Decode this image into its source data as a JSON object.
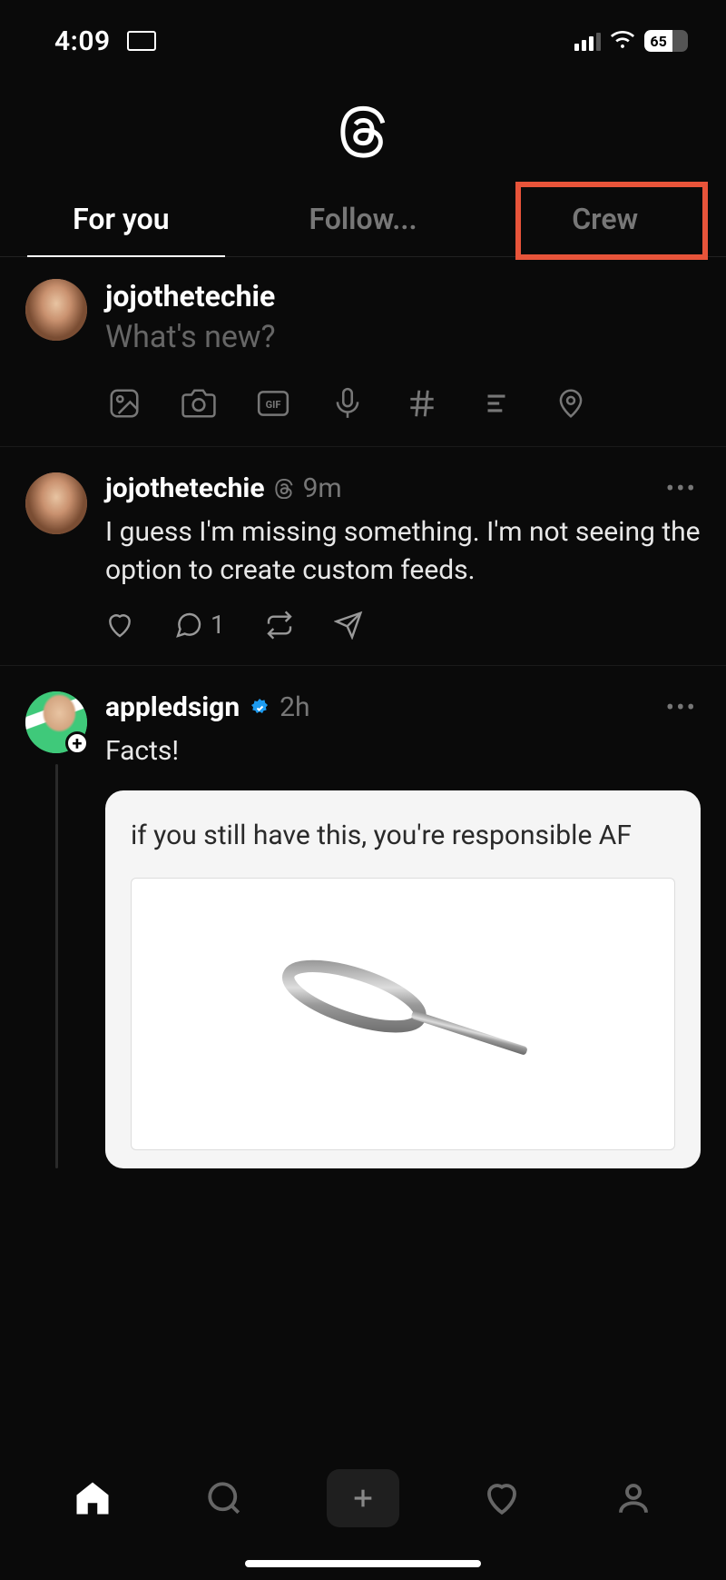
{
  "status": {
    "time": "4:09",
    "battery": "65"
  },
  "tabs": {
    "for_you": "For you",
    "following": "Follow...",
    "crew": "Crew"
  },
  "composer": {
    "username": "jojothetechie",
    "placeholder": "What's new?"
  },
  "posts": [
    {
      "username": "jojothetechie",
      "time": "9m",
      "text": "I guess I'm missing something. I'm not seeing the option to create custom feeds.",
      "reply_count": "1"
    },
    {
      "username": "appledsign",
      "time": "2h",
      "text": "Facts!",
      "image_caption": "if you still have this, you're responsible AF"
    }
  ]
}
